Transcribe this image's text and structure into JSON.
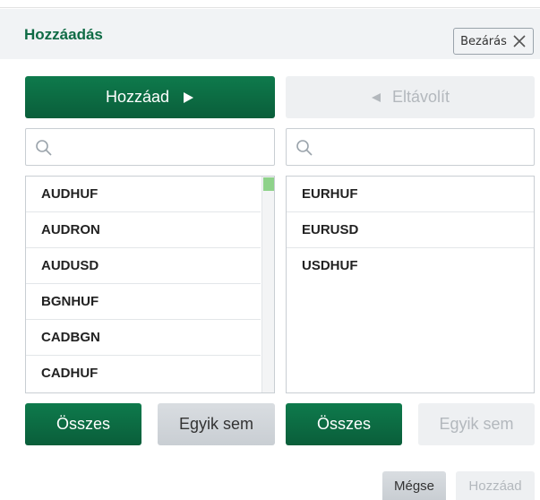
{
  "dialog": {
    "title": "Hozzáadás",
    "close_label": "Bezárás"
  },
  "actions": {
    "add_label": "Hozzáad",
    "remove_label": "Eltávolít"
  },
  "left_panel": {
    "search_placeholder": "",
    "items": [
      "AUDHUF",
      "AUDRON",
      "AUDUSD",
      "BGNHUF",
      "CADBGN",
      "CADHUF"
    ],
    "all_label": "Összes",
    "none_label": "Egyik sem"
  },
  "right_panel": {
    "search_placeholder": "",
    "items": [
      "EURHUF",
      "EURUSD",
      "USDHUF"
    ],
    "all_label": "Összes",
    "none_label": "Egyik sem"
  },
  "footer": {
    "cancel_label": "Mégse",
    "confirm_label": "Hozzáad"
  },
  "colors": {
    "accent": "#0e7a4c",
    "scroll_thumb": "#8ed28a"
  }
}
